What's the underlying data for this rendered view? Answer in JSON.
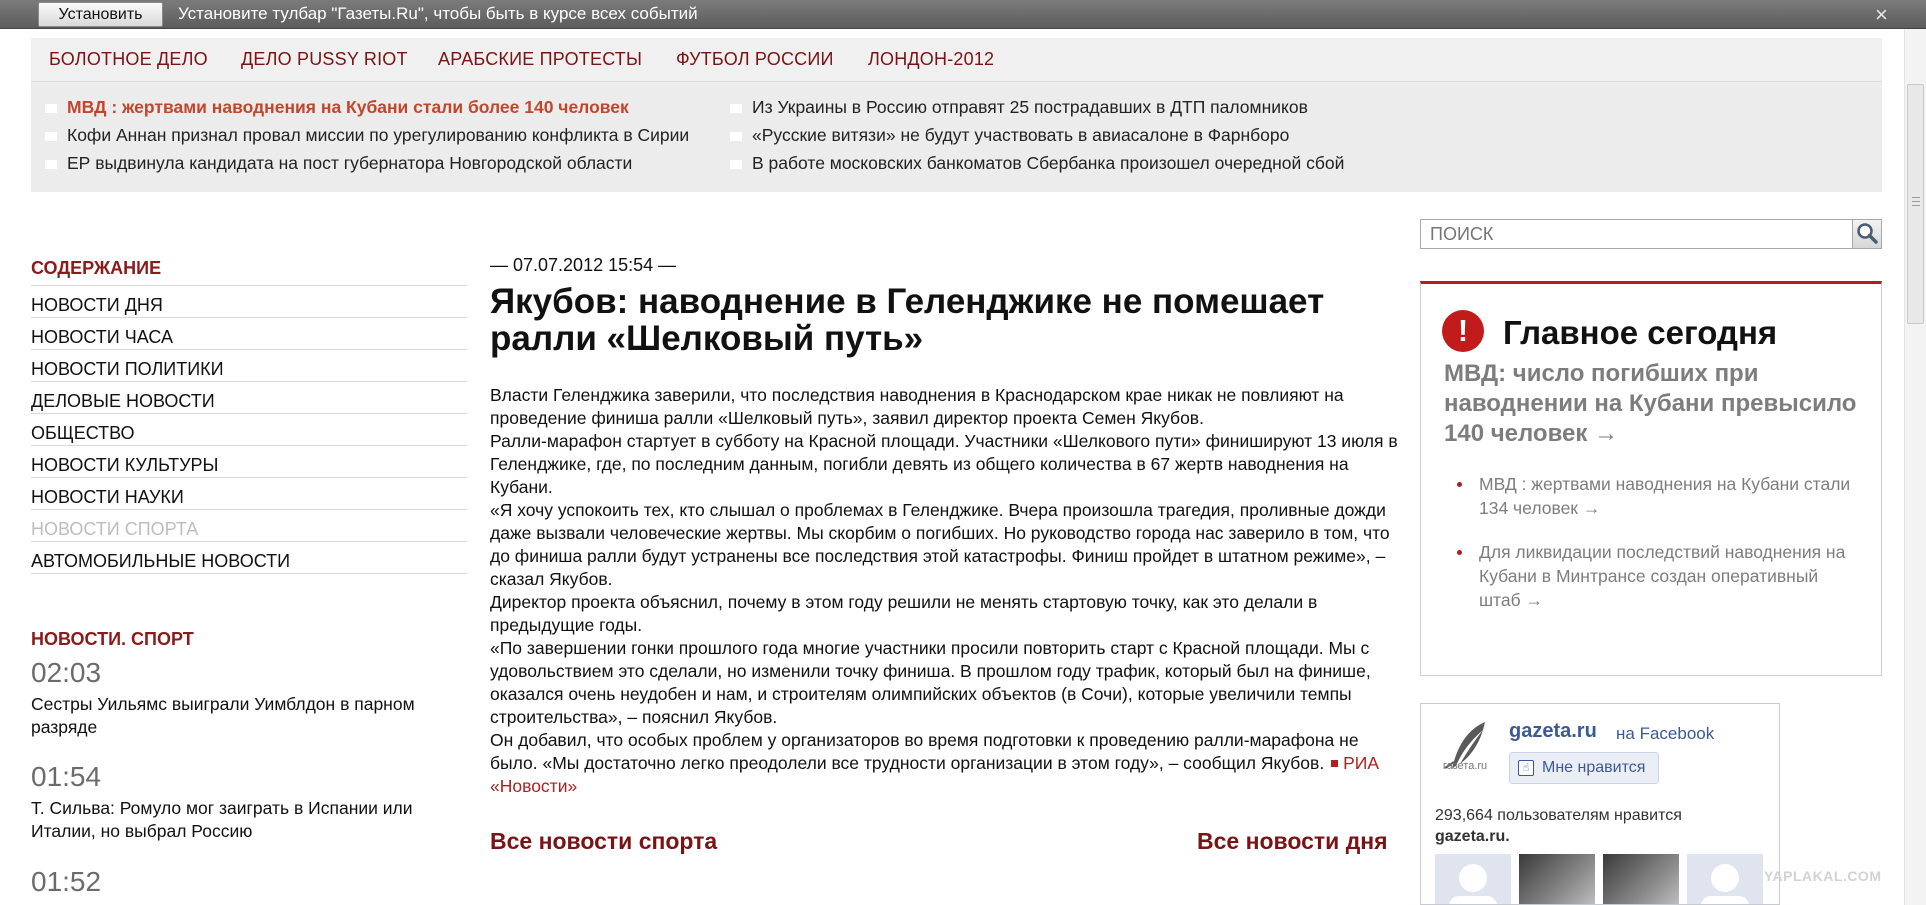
{
  "install_bar": {
    "button": "Установить",
    "text": "Установите тулбар \"Газеты.Ru\", чтобы быть в курсе всех событий",
    "close": "×"
  },
  "topnav": [
    "БОЛОТНОЕ ДЕЛО",
    "ДЕЛО PUSSY RIOT",
    "АРАБСКИЕ ПРОТЕСТЫ",
    "ФУТБОЛ РОССИИ",
    "ЛОНДОН-2012"
  ],
  "headlines": {
    "left": [
      "МВД : жертвами наводнения на Кубани стали более 140 человек",
      "Кофи Аннан признал провал миссии по урегулированию конфликта в Сирии",
      "ЕР выдвинула кандидата на пост губернатора Новгородской области"
    ],
    "right": [
      "Из Украины в Россию отправят 25 пострадавших в ДТП паломников",
      "«Русские витязи» не будут участвовать в авиасалоне в Фарнборо",
      "В работе московских банкоматов Сбербанка произошел очередной сбой"
    ]
  },
  "contents": {
    "title": "СОДЕРЖАНИЕ",
    "items": [
      "НОВОСТИ ДНЯ",
      "НОВОСТИ ЧАСА",
      "НОВОСТИ ПОЛИТИКИ",
      "ДЕЛОВЫЕ НОВОСТИ",
      "ОБЩЕСТВО",
      "НОВОСТИ КУЛЬТУРЫ",
      "НОВОСТИ НАУКИ",
      "НОВОСТИ СПОРТА",
      "АВТОМОБИЛЬНЫЕ НОВОСТИ"
    ]
  },
  "sport_news": {
    "title": "НОВОСТИ. СПОРТ",
    "items": [
      {
        "time": "02:03",
        "text": "Сестры Уильямс выиграли Уимблдон в парном разряде"
      },
      {
        "time": "01:54",
        "text": "Т. Сильва: Ромуло мог заиграть в Испании или Италии, но выбрал Россию"
      },
      {
        "time": "01:52",
        "text": ""
      }
    ]
  },
  "article": {
    "dateline": "— 07.07.2012 15:54 —",
    "title": "Якубов: наводнение в Геленджике не помешает ралли «Шелковый путь»",
    "paragraphs": [
      "Власти Геленджика заверили, что последствия наводнения в Краснодарском крае никак не повлияют на проведение финиша ралли «Шелковый путь», заявил директор проекта Семен Якубов.",
      "Ралли-марафон стартует в субботу на Красной площади. Участники «Шелкового пути» финишируют 13 июля в Геленджике, где, по последним данным, погибли девять из общего количества в 67 жертв наводнения на Кубани.",
      "«Я хочу успокоить тех, кто слышал о проблемах в Геленджике. Вчера произошла трагедия, проливные дожди даже вызвали человеческие жертвы. Мы скорбим о погибших. Но руководство города нас заверило в том, что до финиша ралли будут устранены все последствия этой катастрофы. Финиш пройдет в штатном режиме», – сказал Якубов.",
      "Директор проекта объяснил, почему в этом году решили не менять стартовую точку, как это делали в предыдущие годы.",
      "«По завершении гонки прошлого года многие участники просили повторить старт с Красной площади. Мы с удовольствием это сделали, но изменили точку финиша. В прошлом году трафик, который был на финише, оказался очень неудобен и нам, и строителям олимпийских объектов (в Сочи), которые увеличили темпы строительства», – пояснил Якубов."
    ],
    "last_paragraph": "Он добавил, что особых проблем у организаторов во время подготовки к проведению ралли-марафона не было. «Мы достаточно легко преодолели все трудности организации в этом году», – сообщил Якубов.",
    "source": "РИА «Новости»",
    "link_sport": "Все новости спорта",
    "link_day": "Все новости дня"
  },
  "search": {
    "placeholder": "ПОИСК"
  },
  "today": {
    "icon": "!",
    "title": "Главное сегодня",
    "lead": "МВД: число погибших при наводнении на Кубани превысило 140 человек →",
    "items": [
      "МВД : жертвами наводнения на Кубани стали 134 человек →",
      "Для ликвидации последствий наводнения на Кубани в Минтрансе создан оперативный штаб →"
    ]
  },
  "facebook": {
    "logo_text": "газета.ru",
    "name": "gazeta.ru",
    "on": "на Facebook",
    "like": "Мне нравится",
    "count": "293,664 пользователям нравится",
    "site": "gazeta.ru."
  },
  "watermark": "YAPLAKAL.COM",
  "colors": {
    "brand": "#7a1414",
    "accent_red": "#b01e1e",
    "hot_headline": "#c0462c",
    "facebook_blue": "#3b5998"
  },
  "icons": [
    "close-icon",
    "search-icon",
    "exclamation-icon",
    "quill-logo-icon",
    "thumbs-up-icon"
  ]
}
